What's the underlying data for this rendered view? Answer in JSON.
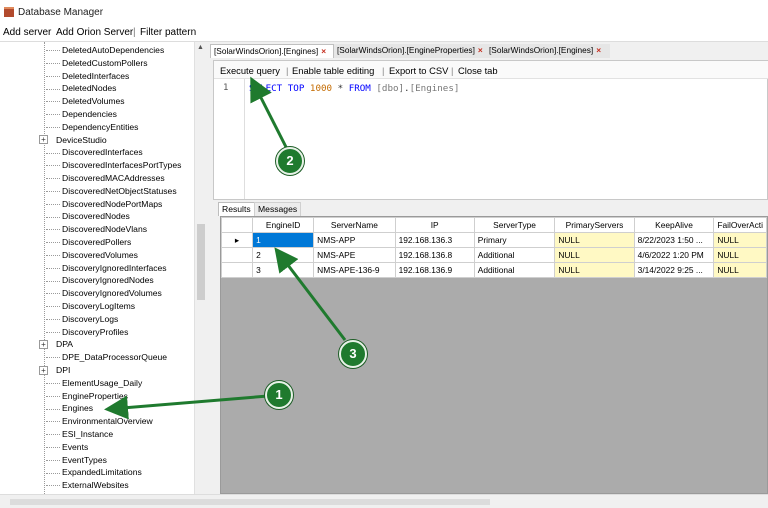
{
  "window": {
    "title": "Database Manager"
  },
  "menu": {
    "add_server": "Add server",
    "add_orion_server": "Add Orion Server",
    "separator": "|",
    "filter_pattern": "Filter pattern"
  },
  "tree": {
    "items": [
      "DeletedAutoDependencies",
      "DeletedCustomPollers",
      "DeletedInterfaces",
      "DeletedNodes",
      "DeletedVolumes",
      "Dependencies",
      "DependencyEntities",
      "DeviceStudio",
      "DiscoveredInterfaces",
      "DiscoveredInterfacesPortTypes",
      "DiscoveredMACAddresses",
      "DiscoveredNetObjectStatuses",
      "DiscoveredNodePortMaps",
      "DiscoveredNodes",
      "DiscoveredNodeVlans",
      "DiscoveredPollers",
      "DiscoveredVolumes",
      "DiscoveryIgnoredInterfaces",
      "DiscoveryIgnoredNodes",
      "DiscoveryIgnoredVolumes",
      "DiscoveryLogItems",
      "DiscoveryLogs",
      "DiscoveryProfiles",
      "DPA",
      "DPE_DataProcessorQueue",
      "DPI",
      "ElementUsage_Daily",
      "EngineProperties",
      "Engines",
      "EnvironmentalOverview",
      "ESI_Instance",
      "Events",
      "EventTypes",
      "ExpandedLimitations",
      "ExternalWebsites"
    ],
    "expander_symbol": "+"
  },
  "tabs": [
    {
      "label": "[SolarWindsOrion].[Engines]"
    },
    {
      "label": "[SolarWindsOrion].[EngineProperties]"
    },
    {
      "label": "[SolarWindsOrion].[Engines]"
    }
  ],
  "tab_close": "×",
  "toolbar": {
    "execute_query": "Execute query",
    "enable_table_editing": "Enable table editing",
    "export_csv": "Export to CSV",
    "close_tab": "Close tab",
    "separator": "|"
  },
  "editor": {
    "line_number": "1",
    "tokens": {
      "select": "SELECT",
      "top": "TOP",
      "count": "1000",
      "star": "*",
      "from": "FROM",
      "schema": "[dbo]",
      "dot": ".",
      "table": "[Engines]"
    }
  },
  "results_tabs": {
    "results": "Results",
    "messages": "Messages"
  },
  "grid": {
    "columns": [
      "EngineID",
      "ServerName",
      "IP",
      "ServerType",
      "PrimaryServers",
      "KeepAlive",
      "FailOverActi"
    ],
    "rows": [
      [
        "1",
        "NMS-APP",
        "192.168.136.3",
        "Primary",
        "NULL",
        "8/22/2023 1:50 ...",
        "NULL"
      ],
      [
        "2",
        "NMS-APE",
        "192.168.136.8",
        "Additional",
        "NULL",
        "4/6/2022 1:20 PM",
        "NULL"
      ],
      [
        "3",
        "NMS-APE-136-9",
        "192.168.136.9",
        "Additional",
        "NULL",
        "3/14/2022 9:25 ...",
        "NULL"
      ]
    ],
    "current_row_marker": "▸"
  },
  "markers": {
    "m1": "1",
    "m2": "2",
    "m3": "3"
  },
  "colors": {
    "arrow": "#1f7a2e",
    "selection": "#0078d7",
    "null_cell": "#fff9c4",
    "keyword": "#0000ff",
    "number": "#c46b00"
  }
}
